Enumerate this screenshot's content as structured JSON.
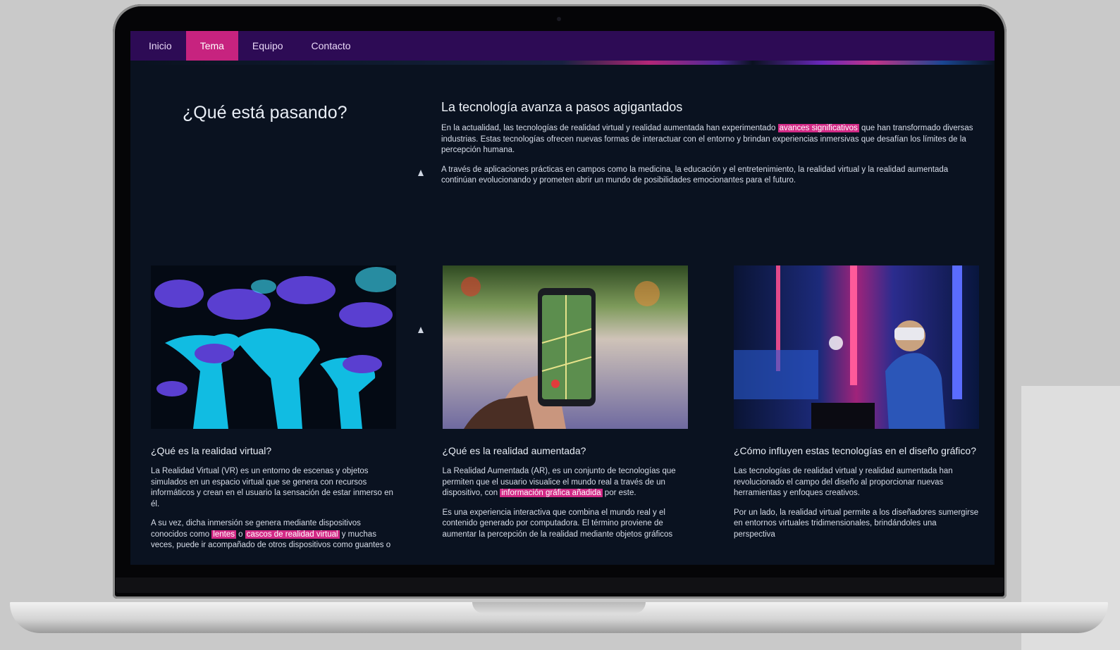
{
  "nav": {
    "items": [
      {
        "label": "Inicio",
        "active": false
      },
      {
        "label": "Tema",
        "active": true
      },
      {
        "label": "Equipo",
        "active": false
      },
      {
        "label": "Contacto",
        "active": false
      }
    ],
    "active_color": "#c7237f",
    "bar_color": "#2d0b55"
  },
  "intro": {
    "title": "¿Qué está pasando?",
    "heading": "La tecnología avanza a pasos agigantados",
    "p1_before": "En la actualidad, las tecnologías de realidad virtual y realidad aumentada han experimentado ",
    "p1_highlight": "avances significativos",
    "p1_after": " que han transformado diversas industrias. Estas tecnologías ofrecen nuevas formas de interactuar con el entorno y brindan experiencias inmersivas que desafían los límites de la percepción humana.",
    "p2": "A través de aplicaciones prácticas en campos como la medicina, la educación y el entretenimiento, la realidad virtual y la realidad aumentada continúan evolucionando y prometen abrir un mundo de posibilidades emocionantes para el futuro."
  },
  "cards": [
    {
      "image_icon": "glowing-forest-image",
      "title": "¿Qué es la realidad virtual?",
      "p1": "La Realidad Virtual (VR) es un entorno de escenas y objetos simulados en un espacio virtual que se genera con recursos informáticos y crean en el usuario la sensación de estar inmerso en él.",
      "p2_a": "A su vez, dicha inmersión se genera mediante dispositivos conocidos como ",
      "p2_hl1": "lentes",
      "p2_b": " o ",
      "p2_hl2": "cascos de realidad virtual",
      "p2_c": " y muchas veces, puede ir acompañado de otros dispositivos como guantes o"
    },
    {
      "image_icon": "phone-ar-game-image",
      "title": "¿Qué es la realidad aumentada?",
      "p1_a": "La Realidad Aumentada (AR), es un conjunto de tecnologías que permiten que el usuario visualice el mundo real a través de un dispositivo, con ",
      "p1_hl": "información gráfica añadida",
      "p1_b": " por este.",
      "p2": "Es una experiencia interactiva que combina el mundo real y el contenido generado por computadora. El término proviene de aumentar la percepción de la realidad mediante objetos gráficos"
    },
    {
      "image_icon": "vr-headset-user-image",
      "title": "¿Cómo influyen estas tecnologías en el diseño gráfico?",
      "p1": "Las tecnologías de realidad virtual y realidad aumentada han revolucionado el campo del diseño al proporcionar nuevas herramientas y enfoques creativos.",
      "p2": "Por un lado, la realidad virtual permite a los diseñadores sumergirse en entornos virtuales tridimensionales, brindándoles una perspectiva"
    }
  ]
}
